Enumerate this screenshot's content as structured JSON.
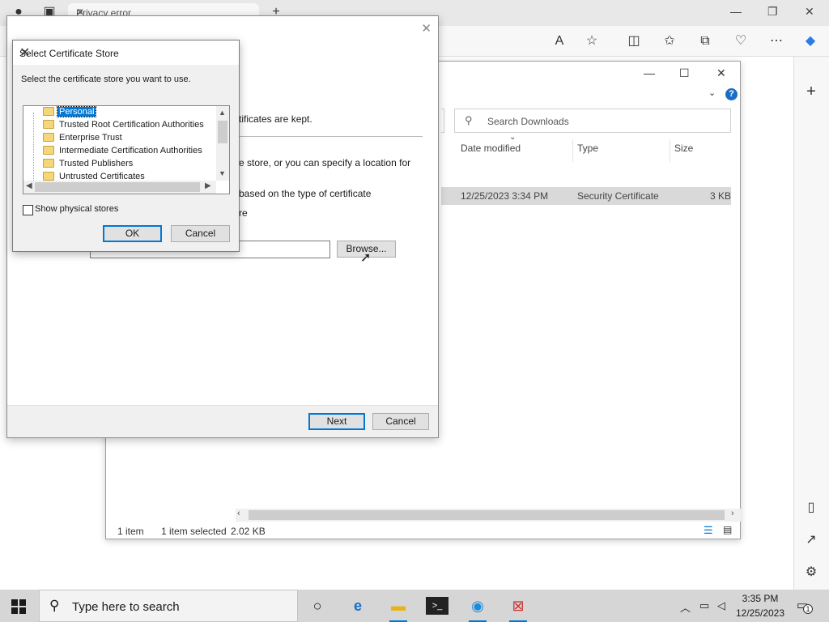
{
  "browser": {
    "tab_title": "Privacy error",
    "toolbar_icons": [
      "read-aloud-icon",
      "favorite-icon",
      "split-screen-icon",
      "favorites-icon",
      "collections-icon",
      "browser-essentials-icon",
      "more-icon",
      "copilot-icon"
    ],
    "side_icons": [
      "add-icon",
      "sidebar-toggle-icon",
      "external-link-icon",
      "gear-icon"
    ]
  },
  "explorer": {
    "search_placeholder": "Search Downloads",
    "columns": [
      "Date modified",
      "Type",
      "Size"
    ],
    "file": {
      "date": "12/25/2023 3:34 PM",
      "type": "Security Certificate",
      "size": "3 KB"
    },
    "status": {
      "count": "1 item",
      "selected": "1 item selected",
      "size": "2.02 KB"
    }
  },
  "wizard": {
    "text1": "rtificates are kept.",
    "text2": "e store, or you can specify a location for",
    "text3": "based on the type of certificate",
    "text4": "re",
    "browse_label": "Browse...",
    "next_label": "Next",
    "cancel_label": "Cancel"
  },
  "cert_dialog": {
    "title": "Select Certificate Store",
    "instruction": "Select the certificate store you want to use.",
    "stores": [
      "Personal",
      "Trusted Root Certification Authorities",
      "Enterprise Trust",
      "Intermediate Certification Authorities",
      "Trusted Publishers",
      "Untrusted Certificates"
    ],
    "selected_store": "Personal",
    "show_physical_label": "Show physical stores",
    "show_physical_checked": false,
    "ok_label": "OK",
    "cancel_label": "Cancel"
  },
  "taskbar": {
    "search_placeholder": "Type here to search",
    "time": "3:35 PM",
    "date": "12/25/2023",
    "notification_count": "1"
  },
  "colors": {
    "accent": "#0078d7",
    "selection": "#d9d9d9"
  }
}
